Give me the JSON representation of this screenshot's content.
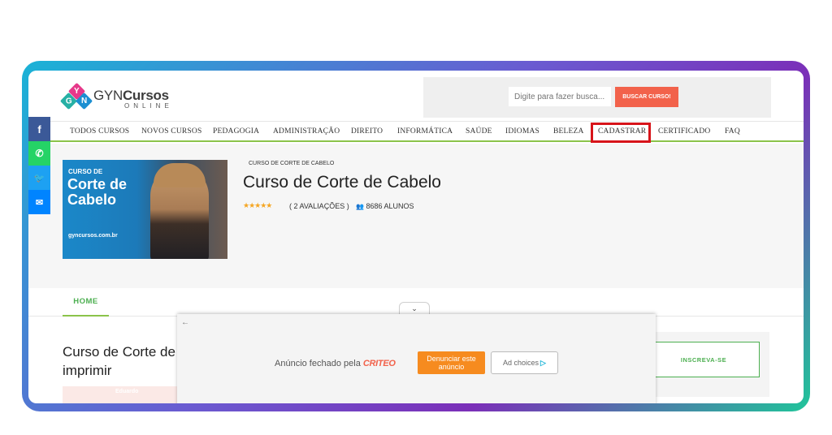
{
  "header": {
    "logo": {
      "letters": [
        "Y",
        "G",
        "N"
      ],
      "brand_light": "GYN",
      "brand_bold": "Cursos",
      "sub": "ONLINE"
    },
    "search": {
      "placeholder": "Digite para fazer busca...",
      "button": "BUSCAR CURSO!"
    }
  },
  "nav": {
    "items": [
      "TODOS CURSOS",
      "NOVOS CURSOS",
      "PEDAGOGIA",
      "ADMINISTRAÇÃO",
      "DIREITO",
      "INFORMÁTICA",
      "SAÚDE",
      "IDIOMAS",
      "BELEZA",
      "CADASTRAR",
      "CERTIFICADO",
      "FAQ"
    ],
    "highlighted": "CADASTRAR"
  },
  "social": {
    "icons": [
      "facebook-icon",
      "whatsapp-icon",
      "twitter-icon",
      "messenger-icon"
    ],
    "glyphs": [
      "f",
      "✆",
      "🐦",
      "✉"
    ]
  },
  "course": {
    "image_small": "CURSO DE",
    "image_big": "Corte de Cabelo",
    "image_site": "gyncursos.com.br",
    "breadcrumb": "CURSO DE CORTE DE CABELO",
    "title": "Curso de Corte de Cabelo",
    "stars": "★★★★★",
    "ratings": "( 2 AVALIAÇÕES )",
    "students": "8686 ALUNOS"
  },
  "tabs": {
    "home": "HOME"
  },
  "content": {
    "title": "Curso de Corte de imprimir",
    "thumb_label": "Eduardo",
    "cta": "INSCREVA-SE"
  },
  "ad": {
    "closed_text": "Anúncio fechado pela",
    "brand": "CRITEO",
    "report": "Denunciar este anúncio",
    "choices": "Ad choices"
  },
  "colors": {
    "accent_green": "#8bc34a",
    "highlight_red": "#d7141a",
    "search_button": "#f2624b",
    "ad_orange": "#f68b1f"
  }
}
